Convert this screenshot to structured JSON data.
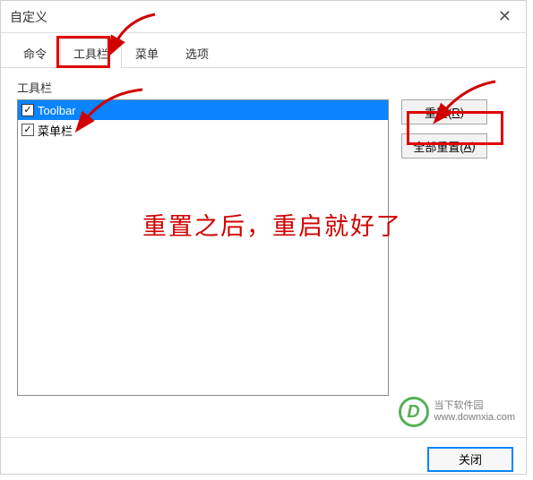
{
  "window": {
    "title": "自定义"
  },
  "tabs": [
    {
      "label": "命令",
      "active": false
    },
    {
      "label": "工具栏",
      "active": true
    },
    {
      "label": "菜单",
      "active": false
    },
    {
      "label": "选项",
      "active": false
    }
  ],
  "section": {
    "label": "工具栏"
  },
  "list": {
    "items": [
      {
        "label": "Toolbar",
        "checked": true,
        "selected": true
      },
      {
        "label": "菜单栏",
        "checked": true,
        "selected": false
      }
    ]
  },
  "buttons": {
    "reset": {
      "label": "重置(",
      "key": "R",
      "suffix": ")"
    },
    "reset_all": {
      "label": "全部重置(",
      "key": "A",
      "suffix": ")"
    },
    "close": "关闭"
  },
  "annotation": {
    "text": "重置之后，重启就好了"
  },
  "watermark": {
    "name": "当下软件园",
    "url": "www.downxia.com",
    "logo_letter": "D"
  }
}
